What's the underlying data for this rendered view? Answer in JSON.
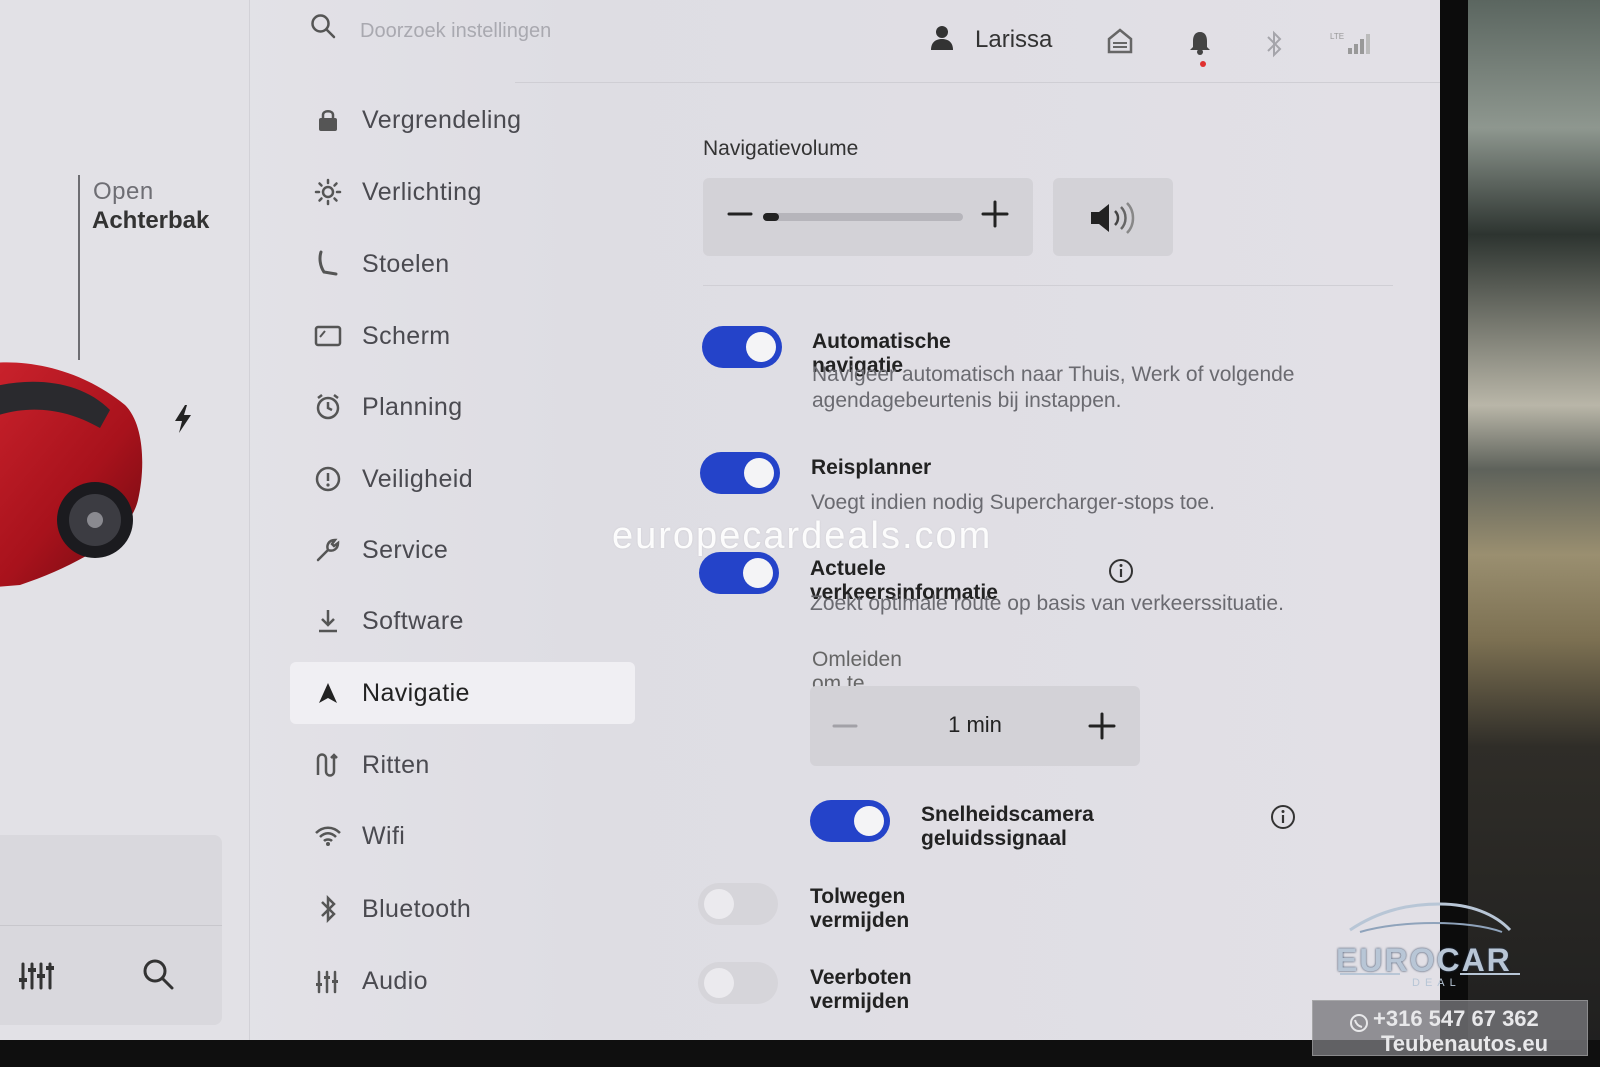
{
  "search": {
    "placeholder": "Doorzoek instellingen"
  },
  "user": {
    "name": "Larissa"
  },
  "car_panel": {
    "trunk_open": "Open",
    "trunk_label": "Achterbak"
  },
  "menu": {
    "items": [
      {
        "label": "Vergrendeling",
        "icon": "lock-icon"
      },
      {
        "label": "Verlichting",
        "icon": "light-icon"
      },
      {
        "label": "Stoelen",
        "icon": "seat-icon"
      },
      {
        "label": "Scherm",
        "icon": "display-icon"
      },
      {
        "label": "Planning",
        "icon": "clock-icon"
      },
      {
        "label": "Veiligheid",
        "icon": "safety-icon"
      },
      {
        "label": "Service",
        "icon": "wrench-icon"
      },
      {
        "label": "Software",
        "icon": "download-icon"
      },
      {
        "label": "Navigatie",
        "icon": "navigation-icon",
        "active": true
      },
      {
        "label": "Ritten",
        "icon": "trips-icon"
      },
      {
        "label": "Wifi",
        "icon": "wifi-icon"
      },
      {
        "label": "Bluetooth",
        "icon": "bluetooth-icon"
      },
      {
        "label": "Audio",
        "icon": "audio-icon"
      }
    ]
  },
  "navigation": {
    "volume_title": "Navigatievolume",
    "volume_level": 0.08,
    "settings": [
      {
        "title": "Automatische navigatie",
        "description": "Navigeer automatisch naar Thuis, Werk of volgende agendagebeurtenis bij instappen.",
        "enabled": true
      },
      {
        "title": "Reisplanner",
        "description": "Voegt indien nodig Supercharger-stops toe.",
        "enabled": true
      },
      {
        "title": "Actuele verkeersinformatie",
        "description": "Zoekt optimale route op basis van verkeerssituatie.",
        "enabled": true
      }
    ],
    "detour": {
      "label": "Omleiden om te besparen",
      "value": "1 min"
    },
    "speed_camera": {
      "title": "Snelheidscamera geluidssignaal",
      "enabled": true
    },
    "avoid_tolls": {
      "title": "Tolwegen vermijden",
      "enabled": false
    },
    "avoid_ferries": {
      "title": "Veerboten vermijden",
      "enabled": false
    }
  },
  "overlays": {
    "watermark": "europecardeals.com",
    "brand": "EUROCAR",
    "brand_sub": "DEAL",
    "phone": "+316 547 67 362",
    "site": "Teubenautos.eu"
  },
  "colors": {
    "toggle_on": "#2443c9",
    "toggle_off": "#d6d5da",
    "active_menu": "#f0eff3"
  }
}
